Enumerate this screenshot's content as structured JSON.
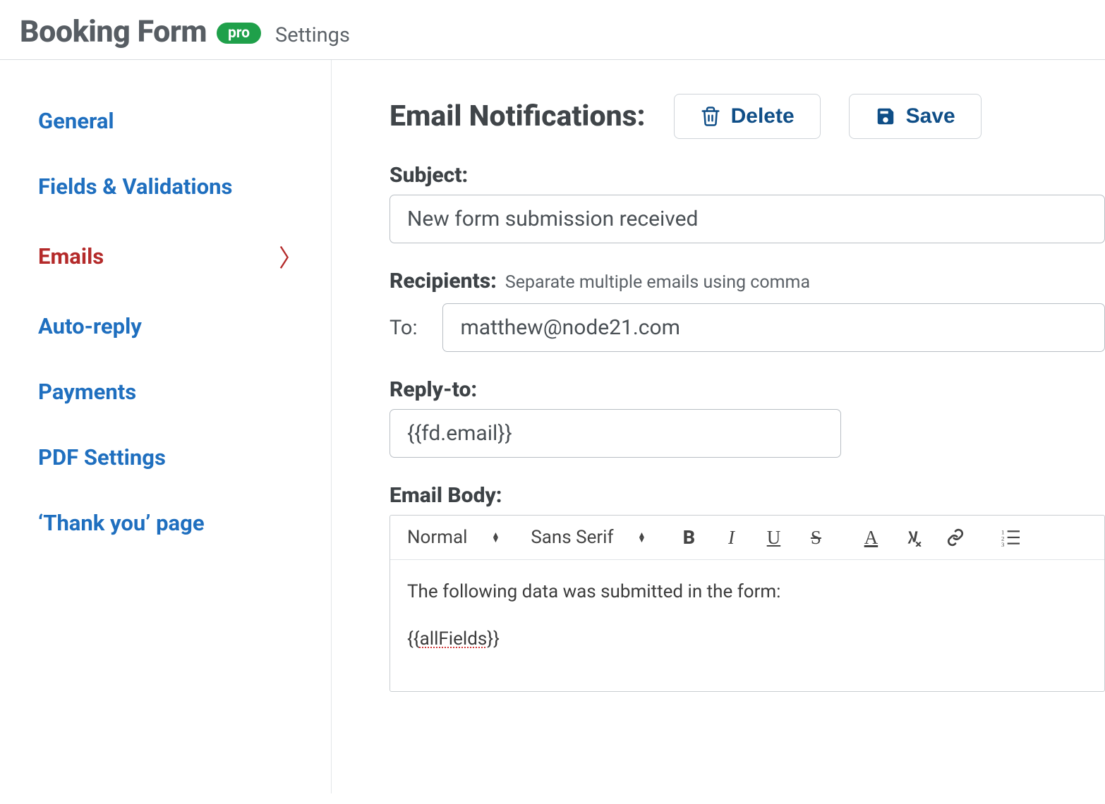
{
  "header": {
    "title": "Booking Form",
    "badge": "pro",
    "subtitle": "Settings"
  },
  "sidebar": {
    "items": [
      {
        "label": "General",
        "active": false
      },
      {
        "label": "Fields & Validations",
        "active": false
      },
      {
        "label": "Emails",
        "active": true
      },
      {
        "label": "Auto-reply",
        "active": false
      },
      {
        "label": "Payments",
        "active": false
      },
      {
        "label": "PDF Settings",
        "active": false
      },
      {
        "label": "‘Thank you’ page",
        "active": false
      }
    ]
  },
  "main": {
    "title": "Email Notifications:",
    "delete_label": "Delete",
    "save_label": "Save",
    "subject": {
      "label": "Subject:",
      "value": "New form submission received"
    },
    "recipients": {
      "label": "Recipients:",
      "hint": "Separate multiple emails using comma",
      "to_label": "To:",
      "to_value": "matthew@node21.com"
    },
    "reply_to": {
      "label": "Reply-to:",
      "value": "{{fd.email}}"
    },
    "body": {
      "label": "Email Body:",
      "toolbar": {
        "heading": "Normal",
        "font": "Sans Serif",
        "bold": "B",
        "italic": "I",
        "underline": "U",
        "strike": "S",
        "color": "A",
        "clear": "Tx"
      },
      "line1": "The following data was submitted in the form:",
      "line2": "{{allFields}}"
    }
  }
}
